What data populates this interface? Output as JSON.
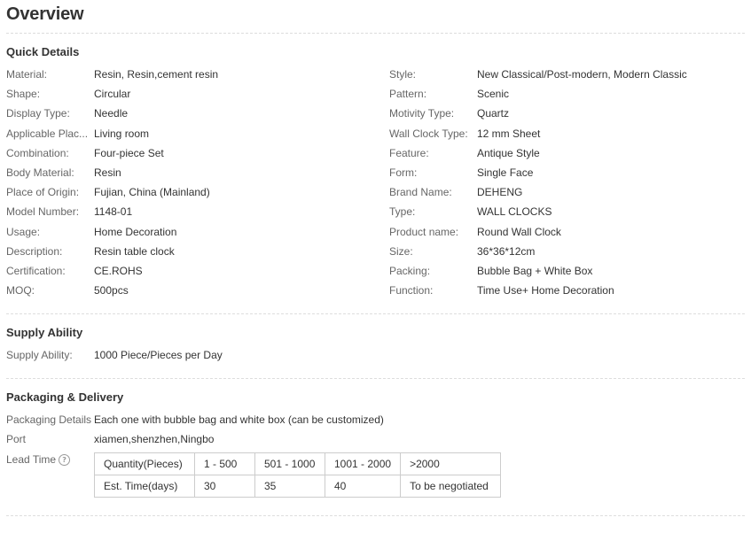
{
  "overview": {
    "title": "Overview"
  },
  "quick_details": {
    "title": "Quick Details",
    "left": [
      {
        "label": "Material:",
        "value": "Resin, Resin,cement resin"
      },
      {
        "label": "Shape:",
        "value": "Circular"
      },
      {
        "label": "Display Type:",
        "value": "Needle"
      },
      {
        "label": "Applicable Plac...",
        "value": "Living room"
      },
      {
        "label": "Combination:",
        "value": "Four-piece Set"
      },
      {
        "label": "Body Material:",
        "value": "Resin"
      },
      {
        "label": "Place of Origin:",
        "value": "Fujian, China (Mainland)"
      },
      {
        "label": "Model Number:",
        "value": "1148-01"
      },
      {
        "label": "Usage:",
        "value": "Home Decoration"
      },
      {
        "label": "Description:",
        "value": "Resin table clock"
      },
      {
        "label": "Certification:",
        "value": "CE.ROHS"
      },
      {
        "label": "MOQ:",
        "value": "500pcs"
      }
    ],
    "right": [
      {
        "label": "Style:",
        "value": "New Classical/Post-modern, Modern Classic"
      },
      {
        "label": "Pattern:",
        "value": "Scenic"
      },
      {
        "label": "Motivity Type:",
        "value": "Quartz"
      },
      {
        "label": "Wall Clock Type:",
        "value": "12 mm Sheet"
      },
      {
        "label": "Feature:",
        "value": "Antique Style"
      },
      {
        "label": "Form:",
        "value": "Single Face"
      },
      {
        "label": "Brand Name:",
        "value": "DEHENG"
      },
      {
        "label": "Type:",
        "value": "WALL CLOCKS"
      },
      {
        "label": "Product name:",
        "value": "Round Wall Clock"
      },
      {
        "label": "Size:",
        "value": "36*36*12cm"
      },
      {
        "label": "Packing:",
        "value": "Bubble Bag + White Box"
      },
      {
        "label": "Function:",
        "value": "Time Use+ Home Decoration"
      }
    ]
  },
  "supply_ability": {
    "title": "Supply Ability",
    "label": "Supply Ability:",
    "value": "1000 Piece/Pieces per Day"
  },
  "packaging_delivery": {
    "title": "Packaging & Delivery",
    "packaging_label": "Packaging Details",
    "packaging_value": "Each one with bubble bag and white box (can be customized)",
    "port_label": "Port",
    "port_value": "xiamen,shenzhen,Ningbo",
    "lead_time_label": "Lead Time",
    "help_icon": "question-circle-icon",
    "lead_table": {
      "rows": [
        [
          "Quantity(Pieces)",
          "1 - 500",
          "501 - 1000",
          "1001 - 2000",
          ">2000"
        ],
        [
          "Est. Time(days)",
          "30",
          "35",
          "40",
          "To be negotiated"
        ]
      ]
    }
  }
}
